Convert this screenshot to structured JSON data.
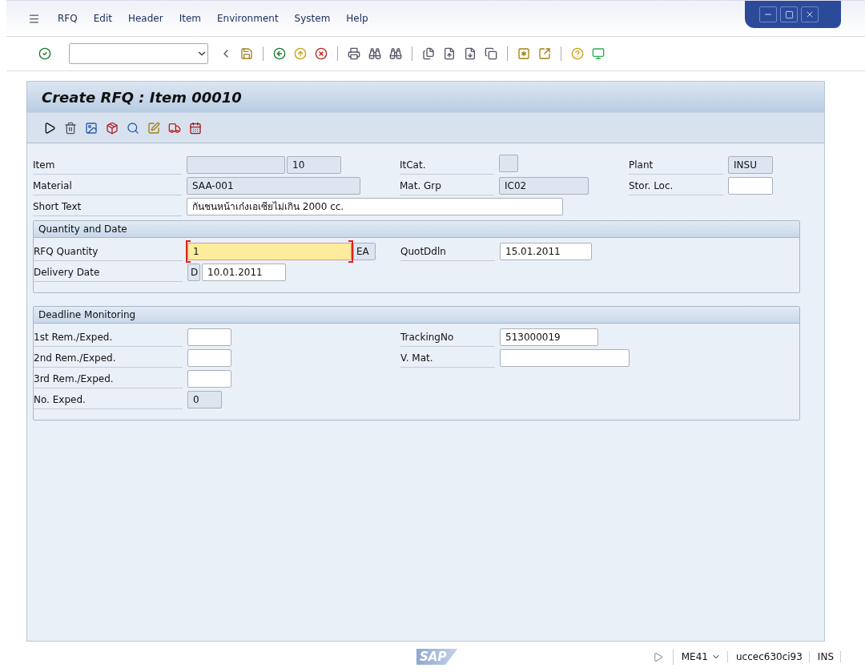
{
  "menu": [
    "RFQ",
    "Edit",
    "Header",
    "Item",
    "Environment",
    "System",
    "Help"
  ],
  "screen_title": "Create RFQ : Item 00010",
  "header_rows": [
    [
      {
        "label": "Item",
        "kind": "pair",
        "value": "10"
      },
      {
        "label": "ItCat.",
        "kind": "display"
      },
      {
        "label": "Plant",
        "kind": "display",
        "value": "INSU"
      }
    ],
    [
      {
        "label": "Material",
        "kind": "display",
        "value": "SAA-001"
      },
      {
        "label": "Mat. Grp",
        "kind": "display",
        "value": "IC02"
      },
      {
        "label": "Stor. Loc.",
        "kind": "input"
      }
    ],
    [
      {
        "label": "Short Text",
        "kind": "input",
        "value": "กันชนหน้าเก๋งเอเซียไม่เกิน 2000 cc."
      }
    ]
  ],
  "groups": [
    {
      "title": "Quantity and Date",
      "rows": [
        [
          {
            "label": "RFQ Quantity",
            "kind": "input",
            "value": "1",
            "focused": true,
            "unit": "EA"
          },
          {
            "label": "QuotDdln",
            "kind": "input",
            "value": "15.01.2011"
          }
        ],
        [
          {
            "label": "Delivery Date",
            "kind": "input",
            "prefix": "D",
            "value": "10.01.2011"
          }
        ]
      ]
    },
    {
      "title": "Deadline Monitoring",
      "rows": [
        [
          {
            "label": "1st Rem./Exped.",
            "kind": "input"
          },
          {
            "label": "TrackingNo",
            "kind": "input",
            "value": "513000019"
          }
        ],
        [
          {
            "label": "2nd Rem./Exped.",
            "kind": "input"
          },
          {
            "label": "V. Mat.",
            "kind": "input"
          }
        ],
        [
          {
            "label": "3rd Rem./Exped.",
            "kind": "input"
          }
        ],
        [
          {
            "label": "No. Exped.",
            "kind": "display",
            "value": "0"
          }
        ]
      ]
    }
  ],
  "status_bar": {
    "logo": "SAP",
    "transaction": "ME41",
    "server": "uccec630ci93",
    "mode": "INS"
  }
}
